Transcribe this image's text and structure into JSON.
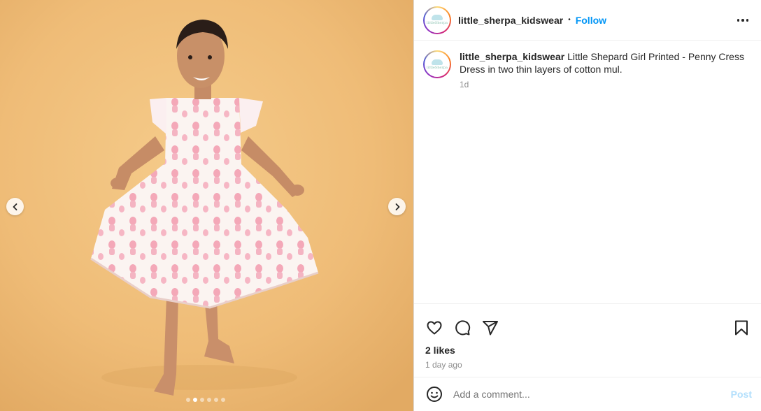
{
  "account": {
    "username": "little_sherpa_kidswear",
    "avatar_text": "littleSherpa",
    "follow_label": "Follow",
    "separator": "•"
  },
  "caption": {
    "username": "little_sherpa_kidswear",
    "text": " Little Shepard Girl Printed - Penny Cress Dress in two thin layers of cotton mul.",
    "time": "1d"
  },
  "engagement": {
    "likes": "2 likes",
    "posted_ago": "1 day ago"
  },
  "comment": {
    "placeholder": "Add a comment...",
    "post_label": "Post"
  },
  "carousel": {
    "slide_count": 6,
    "active_index": 1
  },
  "icons": {
    "more": "more-options-icon",
    "like": "heart-icon",
    "comment": "comment-bubble-icon",
    "share": "paper-plane-icon",
    "save": "bookmark-icon",
    "emoji": "smiley-icon",
    "prev": "chevron-left-icon",
    "next": "chevron-right-icon"
  },
  "colors": {
    "accent": "#0095f6",
    "background_photo": "#efbd78",
    "dress_print": "#f2a3b3"
  }
}
